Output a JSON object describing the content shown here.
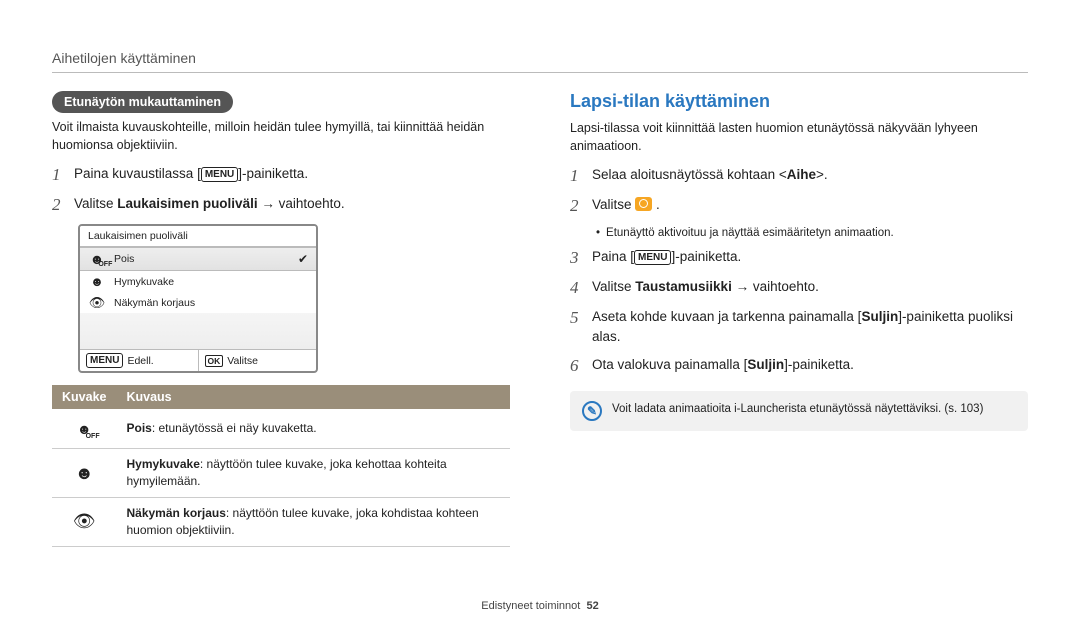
{
  "breadcrumb": "Aihetilojen käyttäminen",
  "left": {
    "pill": "Etunäytön mukauttaminen",
    "intro": "Voit ilmaista kuvauskohteille, milloin heidän tulee hymyillä, tai kiinnittää heidän huomionsa objektiiviin.",
    "step1_pre": "Paina kuvaustilassa [",
    "step1_menu": "MENU",
    "step1_post": "]-painiketta.",
    "step2_pre": "Valitse ",
    "step2_bold": "Laukaisimen puoliväli",
    "step2_post": " → vaihtoehto.",
    "mock": {
      "title": "Laukaisimen puoliväli",
      "row1": "Pois",
      "row2": "Hymykuvake",
      "row3": "Näkymän korjaus",
      "back_badge": "MENU",
      "back_label": "Edell.",
      "ok_badge": "OK",
      "ok_label": "Valitse"
    },
    "table": {
      "h1": "Kuvake",
      "h2": "Kuvaus",
      "r1_bold": "Pois",
      "r1_rest": ": etunäytössä ei näy kuvaketta.",
      "r2_bold": "Hymykuvake",
      "r2_rest": ": näyttöön tulee kuvake, joka kehottaa kohteita hymyilemään.",
      "r3_bold": "Näkymän korjaus",
      "r3_rest": ": näyttöön tulee kuvake, joka kohdistaa kohteen huomion objektiiviin."
    }
  },
  "right": {
    "heading": "Lapsi-tilan käyttäminen",
    "intro": "Lapsi-tilassa voit kiinnittää lasten huomion etunäytössä näkyvään lyhyeen animaatioon.",
    "step1": "Selaa aloitusnäytössä kohtaan <Aihe>.",
    "step2": "Valitse ",
    "step2_bullet": "Etunäyttö aktivoituu ja näyttää esimääritetyn animaation.",
    "step3_pre": "Paina [",
    "step3_menu": "MENU",
    "step3_post": "]-painiketta.",
    "step4_pre": "Valitse ",
    "step4_bold": "Taustamusiikki",
    "step4_post": " → vaihtoehto.",
    "step5_a": "Aseta kohde kuvaan ja tarkenna painamalla [",
    "step5_bold": "Suljin",
    "step5_b": "]-painiketta puoliksi alas.",
    "step6_a": "Ota valokuva painamalla [",
    "step6_bold": "Suljin",
    "step6_b": "]-painiketta.",
    "info": "Voit ladata animaatioita i-Launcherista etunäytössä näytettäviksi. (s. 103)"
  },
  "footer_label": "Edistyneet toiminnot",
  "footer_page": "52"
}
